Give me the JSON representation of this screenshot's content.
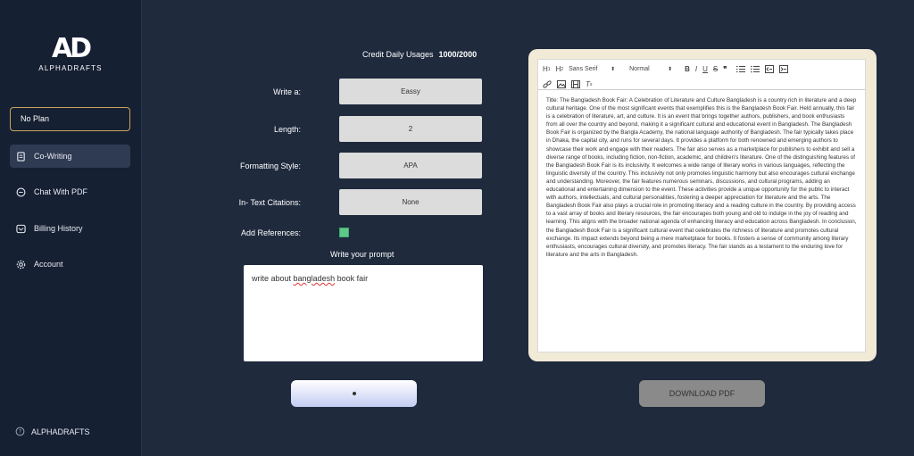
{
  "sidebar": {
    "logo_mark": "AD",
    "logo_text": "ALPHADRAFTS",
    "plan": "No Plan",
    "items": [
      {
        "label": "Co-Writing",
        "icon": "document-icon"
      },
      {
        "label": "Chat With PDF",
        "icon": "chat-icon"
      },
      {
        "label": "Billing History",
        "icon": "mail-icon"
      },
      {
        "label": "Account",
        "icon": "gear-icon"
      }
    ],
    "footer": "ALPHADRAFTS"
  },
  "credit": {
    "label": "Credit Daily Usages",
    "value": "1000/2000"
  },
  "form": {
    "write_a": {
      "label": "Write a:",
      "value": "Eassy"
    },
    "length": {
      "label": "Length:",
      "value": "2"
    },
    "formatting": {
      "label": "Formatting Style:",
      "value": "APA"
    },
    "citations": {
      "label": "In- Text Citations:",
      "value": "None"
    },
    "references": {
      "label": "Add References:",
      "checked": true
    },
    "prompt_label": "Write your prompt",
    "prompt_before": "write about ",
    "prompt_squiggle": "bangladesh",
    "prompt_after": " book fair"
  },
  "editor": {
    "font": "Sans Serif",
    "size": "Normal",
    "content": "Title: The Bangladesh Book Fair: A Celebration of Literature and Culture Bangladesh is a country rich in literature and a deep cultural heritage. One of the most significant events that exemplifies this is the Bangladesh Book Fair. Held annually, this fair is a celebration of literature, art, and culture. It is an event that brings together authors, publishers, and book enthusiasts from all over the country and beyond, making it a significant cultural and educational event in Bangladesh. The Bangladesh Book Fair is organized by the Bangla Academy, the national language authority of Bangladesh. The fair typically takes place in Dhaka, the capital city, and runs for several days. It provides a platform for both renowned and emerging authors to showcase their work and engage with their readers. The fair also serves as a marketplace for publishers to exhibit and sell a diverse range of books, including fiction, non-fiction, academic, and children's literature. One of the distinguishing features of the Bangladesh Book Fair is its inclusivity. It welcomes a wide range of literary works in various languages, reflecting the linguistic diversity of the country. This inclusivity not only promotes linguistic harmony but also encourages cultural exchange and understanding. Moreover, the fair features numerous seminars, discussions, and cultural programs, adding an educational and entertaining dimension to the event. These activities provide a unique opportunity for the public to interact with authors, intellectuals, and cultural personalities, fostering a deeper appreciation for literature and the arts. The Bangladesh Book Fair also plays a crucial role in promoting literacy and a reading culture in the country. By providing access to a vast array of books and literary resources, the fair encourages both young and old to indulge in the joy of reading and learning. This aligns with the broader national agenda of enhancing literacy and education across Bangladesh. In conclusion, the Bangladesh Book Fair is a significant cultural event that celebrates the richness of literature and promotes cultural exchange. Its impact extends beyond being a mere marketplace for books. It fosters a sense of community among literary enthusiasts, encourages cultural diversity, and promotes literacy. The fair stands as a testament to the enduring love for literature and the arts in Bangladesh."
  },
  "download_label": "DOWNLOAD PDF",
  "colors": {
    "bg": "#1f2a3d",
    "sidebar": "#162033",
    "plan_border": "#c9a45a",
    "checkbox": "#5cc98a",
    "editor_frame": "#f1ead6"
  }
}
